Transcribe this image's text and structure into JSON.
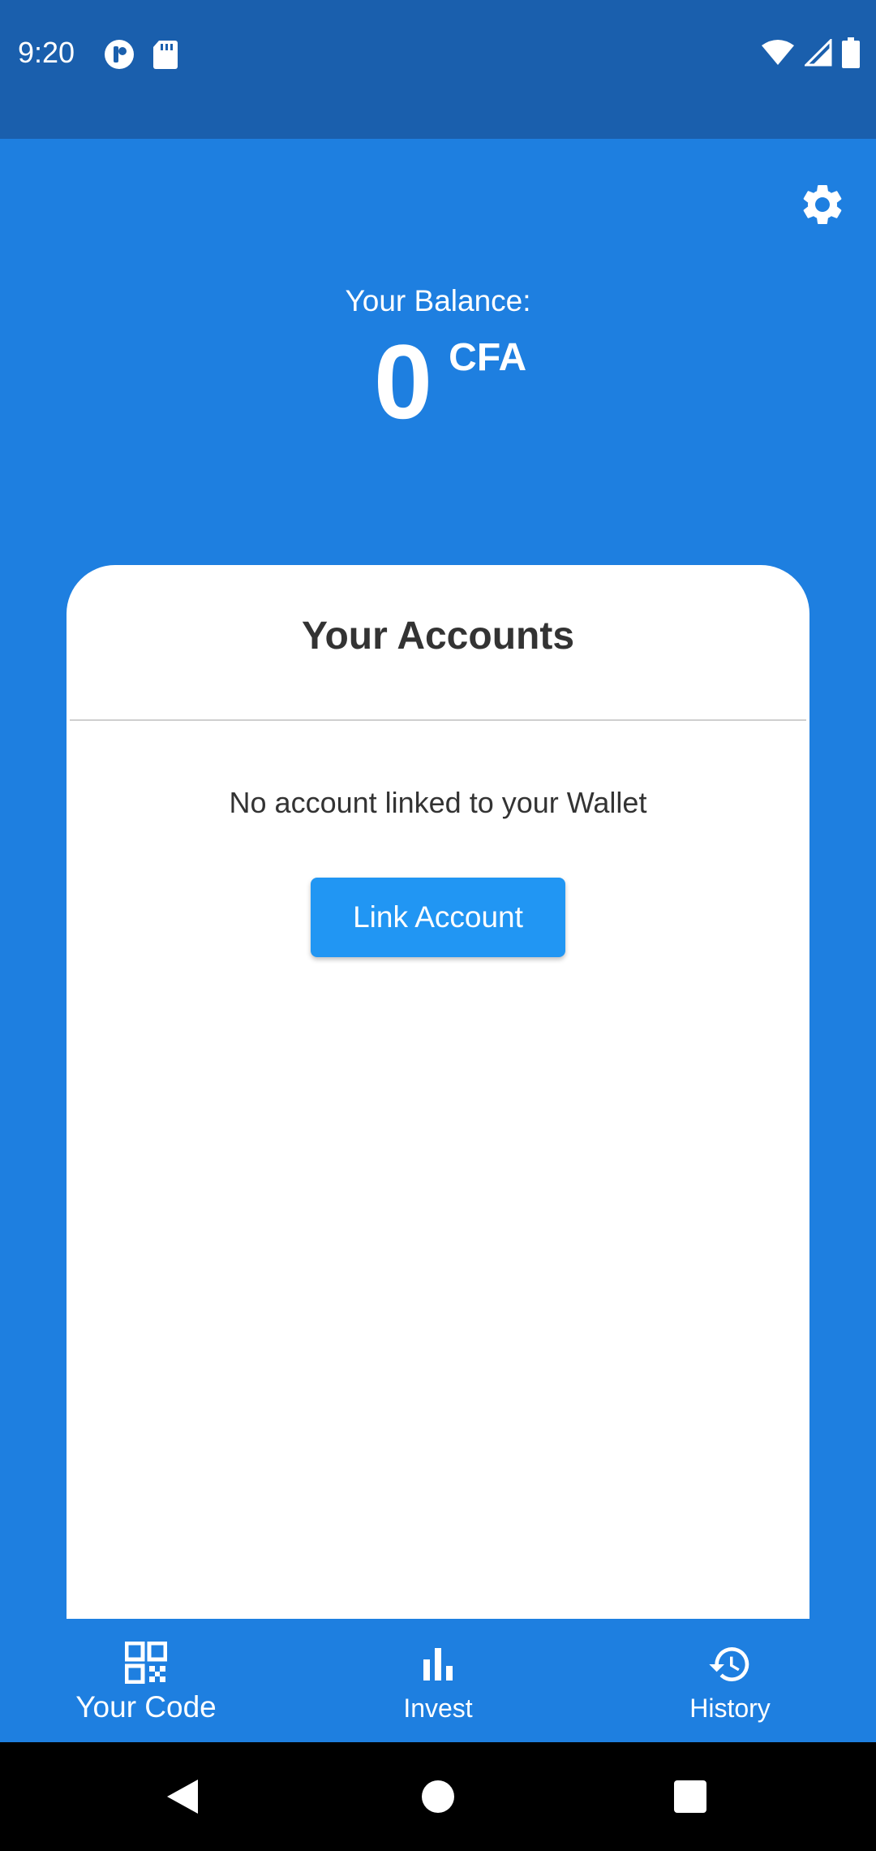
{
  "status_bar": {
    "time": "9:20",
    "left_icons": [
      "notification-app-icon",
      "sd-card-icon"
    ],
    "right_icons": [
      "wifi-icon",
      "cell-signal-icon",
      "battery-icon"
    ]
  },
  "header": {
    "settings_icon": "gear-icon"
  },
  "balance": {
    "label": "Your Balance:",
    "amount": "0",
    "currency": "CFA"
  },
  "accounts_card": {
    "title": "Your Accounts",
    "empty_message": "No account linked to your Wallet",
    "link_button_label": "Link Account"
  },
  "bottom_nav": {
    "items": [
      {
        "label": "Your Code",
        "icon": "qr-code-icon",
        "active": true
      },
      {
        "label": "Invest",
        "icon": "bar-chart-icon",
        "active": false
      },
      {
        "label": "History",
        "icon": "history-icon",
        "active": false
      }
    ]
  },
  "system_nav": {
    "buttons": [
      "back-icon",
      "home-icon",
      "recents-icon"
    ]
  },
  "colors": {
    "status_bar": "#1a5fad",
    "primary": "#1e7fe0",
    "button": "#2196f3",
    "card": "#ffffff",
    "text_dark": "#333333"
  }
}
